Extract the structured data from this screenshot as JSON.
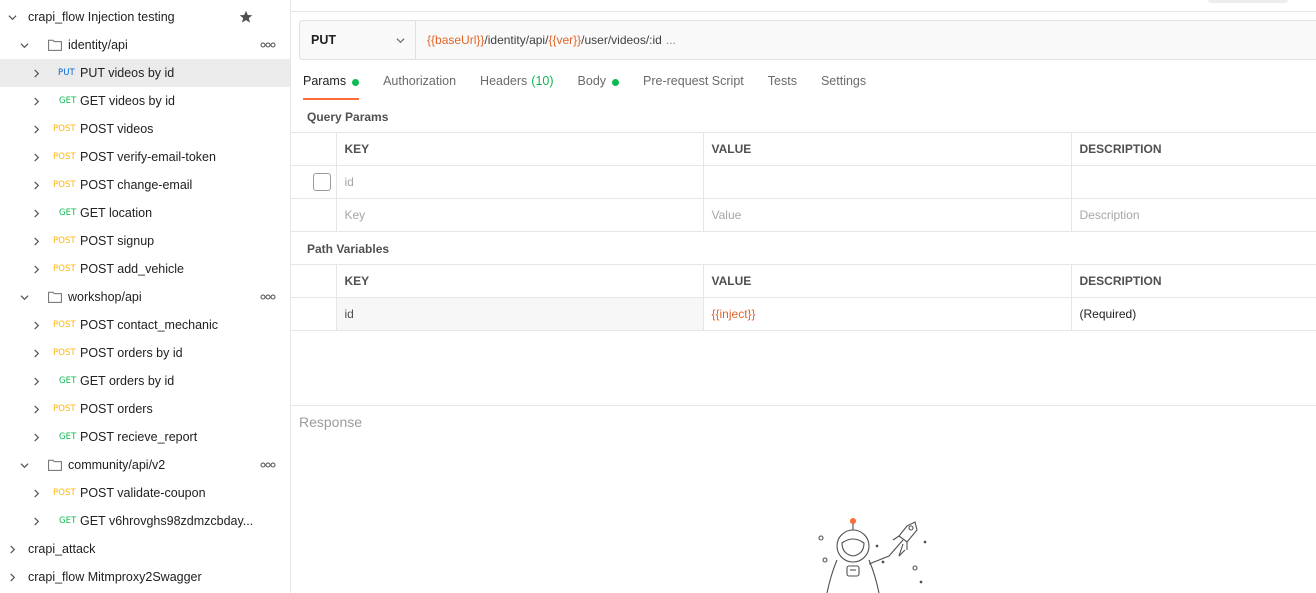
{
  "sidebar": {
    "collection_title": "crapi_flow Injection testing",
    "folders": [
      {
        "label": "identity/api"
      },
      {
        "label": "workshop/api"
      },
      {
        "label": "community/api/v2"
      }
    ],
    "requests": [
      {
        "method": "PUT",
        "label": "PUT videos by id"
      },
      {
        "method": "GET",
        "label": "GET videos by id"
      },
      {
        "method": "POST",
        "label": "POST videos"
      },
      {
        "method": "POST",
        "label": "POST verify-email-token"
      },
      {
        "method": "POST",
        "label": "POST change-email"
      },
      {
        "method": "GET",
        "label": "GET location"
      },
      {
        "method": "POST",
        "label": "POST signup"
      },
      {
        "method": "POST",
        "label": "POST add_vehicle"
      },
      {
        "method": "POST",
        "label": "POST contact_mechanic"
      },
      {
        "method": "POST",
        "label": "POST orders by id"
      },
      {
        "method": "GET",
        "label": "GET orders by id"
      },
      {
        "method": "POST",
        "label": "POST orders"
      },
      {
        "method": "GET",
        "label": "POST recieve_report"
      },
      {
        "method": "POST",
        "label": "POST validate-coupon"
      },
      {
        "method": "GET",
        "label": "GET v6hrovghs98zdmzcbday..."
      }
    ],
    "collections": [
      {
        "label": "crapi_attack"
      },
      {
        "label": "crapi_flow Mitmproxy2Swagger"
      }
    ]
  },
  "request": {
    "method": "PUT",
    "url": {
      "base_var": "{{baseUrl}}",
      "seg1": "/identity/api/",
      "ver_var": "{{ver}}",
      "seg2": "/user/videos/:id",
      "more": "..."
    }
  },
  "tabs": [
    {
      "label": "Params",
      "dot": true
    },
    {
      "label": "Authorization"
    },
    {
      "label": "Headers",
      "count": "(10)"
    },
    {
      "label": "Body",
      "dot": true
    },
    {
      "label": "Pre-request Script"
    },
    {
      "label": "Tests"
    },
    {
      "label": "Settings"
    }
  ],
  "query_params": {
    "title": "Query Params",
    "headers": {
      "key": "KEY",
      "value": "VALUE",
      "description": "DESCRIPTION"
    },
    "row": {
      "key": "id",
      "value": "",
      "description": ""
    },
    "placeholder": {
      "key": "Key",
      "value": "Value",
      "description": "Description"
    }
  },
  "path_variables": {
    "title": "Path Variables",
    "headers": {
      "key": "KEY",
      "value": "VALUE",
      "description": "DESCRIPTION"
    },
    "row": {
      "key": "id",
      "value": "{{inject}}",
      "description": "(Required)"
    }
  },
  "response": {
    "label": "Response"
  },
  "colors": {
    "accent": "#ff6c37",
    "get": "#0cbb52",
    "post": "#ffb400",
    "put": "#0265d2",
    "variable": "#e0642a"
  }
}
